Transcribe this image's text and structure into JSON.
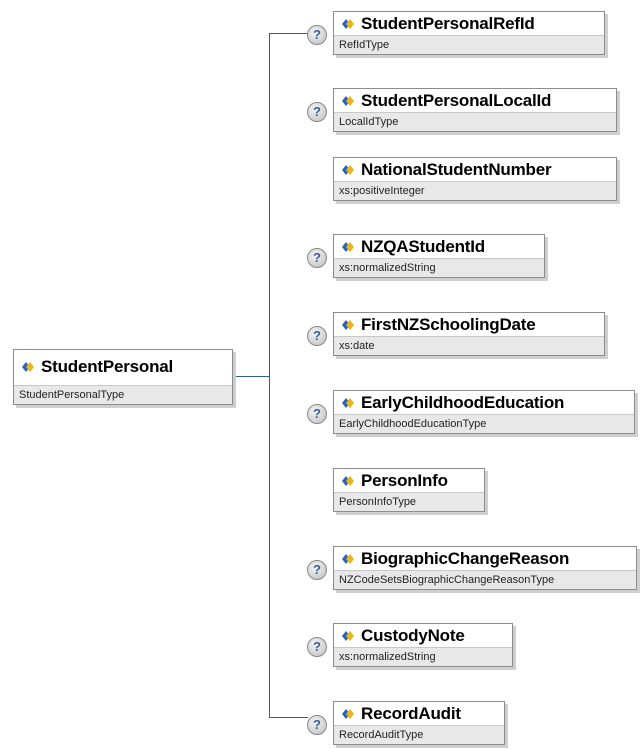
{
  "root": {
    "name": "StudentPersonal",
    "type": "StudentPersonalType"
  },
  "children": [
    {
      "name": "StudentPersonalRefId",
      "type": "RefIdType",
      "optional": true
    },
    {
      "name": "StudentPersonalLocalId",
      "type": "LocalIdType",
      "optional": true
    },
    {
      "name": "NationalStudentNumber",
      "type": "xs:positiveInteger",
      "optional": false
    },
    {
      "name": "NZQAStudentId",
      "type": "xs:normalizedString",
      "optional": true
    },
    {
      "name": "FirstNZSchoolingDate",
      "type": "xs:date",
      "optional": true
    },
    {
      "name": "EarlyChildhoodEducation",
      "type": "EarlyChildhoodEducationType",
      "optional": true
    },
    {
      "name": "PersonInfo",
      "type": "PersonInfoType",
      "optional": false
    },
    {
      "name": "BiographicChangeReason",
      "type": "NZCodeSetsBiographicChangeReasonType",
      "optional": true
    },
    {
      "name": "CustodyNote",
      "type": "xs:normalizedString",
      "optional": true
    },
    {
      "name": "RecordAudit",
      "type": "RecordAuditType",
      "optional": true
    }
  ],
  "optional_marker": "?",
  "colors": {
    "icon_blue": "#2a64b8",
    "icon_gold": "#e9b41c",
    "type_bg": "#e8e8e8",
    "border": "#8c8c8c"
  }
}
